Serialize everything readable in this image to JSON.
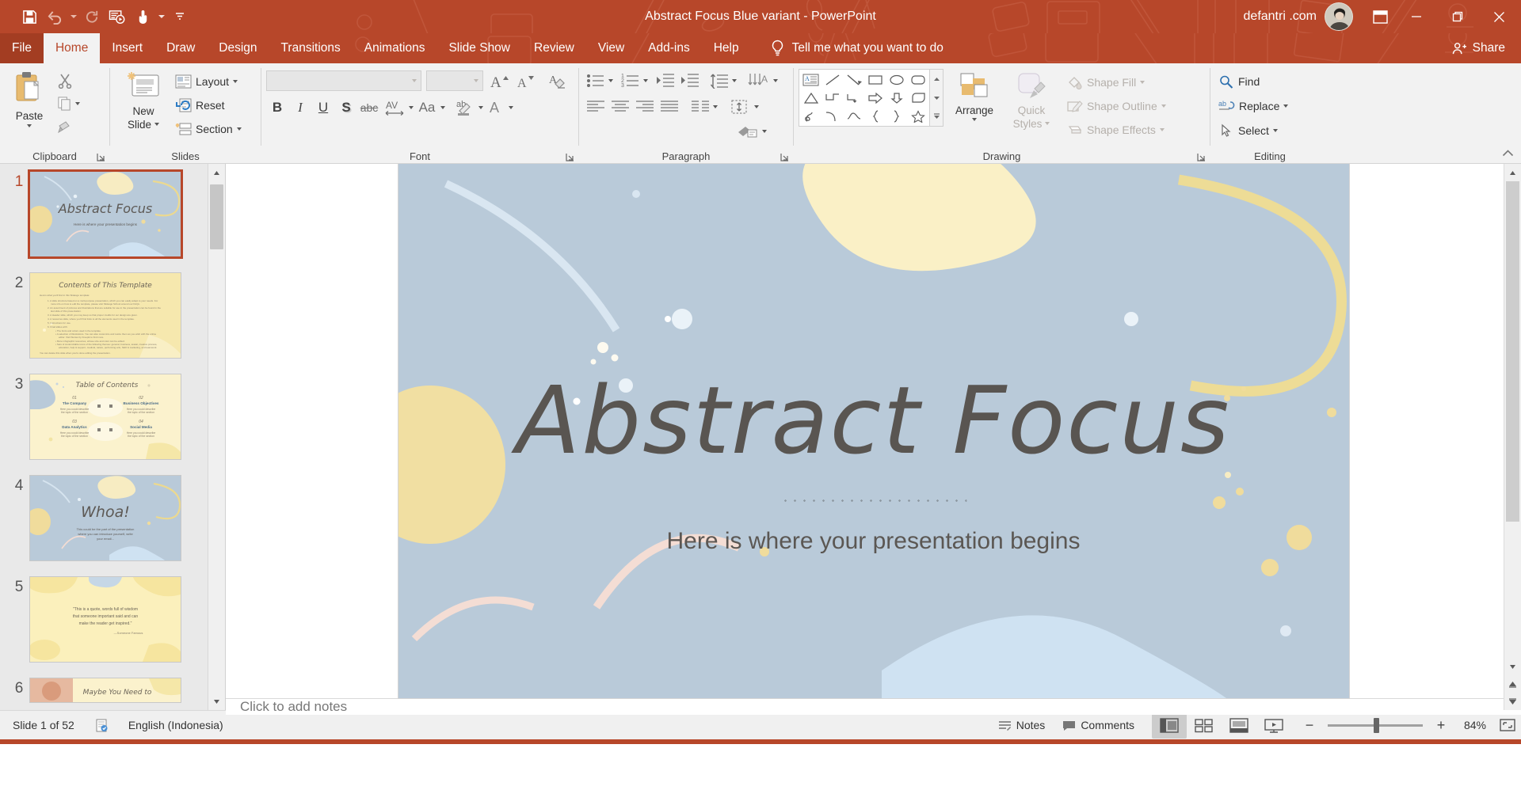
{
  "window": {
    "title": "Abstract Focus Blue variant  -  PowerPoint",
    "account_name": "defantri .com",
    "accent_color": "#b7472a",
    "quick_access": [
      {
        "name": "save",
        "icon": "save-icon"
      },
      {
        "name": "undo",
        "icon": "undo-icon"
      },
      {
        "name": "redo",
        "icon": "redo-icon"
      },
      {
        "name": "start-from-beginning",
        "icon": "slideshow-icon"
      },
      {
        "name": "touch-mouse-mode",
        "icon": "touch-icon"
      },
      {
        "name": "customize-quick-access-toolbar",
        "icon": "chevron-down-icon"
      }
    ],
    "controls": {
      "ribbon_display": "ribbon-display-options-icon",
      "minimize": "minimize-icon",
      "restore": "restore-icon",
      "close": "close-icon"
    }
  },
  "tabs": [
    {
      "label": "File",
      "active": false,
      "file": true
    },
    {
      "label": "Home",
      "active": true,
      "file": false
    },
    {
      "label": "Insert",
      "active": false,
      "file": false
    },
    {
      "label": "Draw",
      "active": false,
      "file": false
    },
    {
      "label": "Design",
      "active": false,
      "file": false
    },
    {
      "label": "Transitions",
      "active": false,
      "file": false
    },
    {
      "label": "Animations",
      "active": false,
      "file": false
    },
    {
      "label": "Slide Show",
      "active": false,
      "file": false
    },
    {
      "label": "Review",
      "active": false,
      "file": false
    },
    {
      "label": "View",
      "active": false,
      "file": false
    },
    {
      "label": "Add-ins",
      "active": false,
      "file": false
    },
    {
      "label": "Help",
      "active": false,
      "file": false
    }
  ],
  "tell_me": {
    "placeholder": "Tell me what you want to do"
  },
  "share": {
    "label": "Share"
  },
  "ribbon": {
    "groups": [
      {
        "name": "clipboard",
        "label": "Clipboard"
      },
      {
        "name": "slides",
        "label": "Slides"
      },
      {
        "name": "font",
        "label": "Font"
      },
      {
        "name": "paragraph",
        "label": "Paragraph"
      },
      {
        "name": "drawing",
        "label": "Drawing"
      },
      {
        "name": "editing",
        "label": "Editing"
      }
    ],
    "clipboard": {
      "paste": "Paste",
      "cut": "Cut",
      "copy": "Copy",
      "format_painter": "Format Painter"
    },
    "slides": {
      "new_slide": "New\nSlide",
      "new_slide_label": "New",
      "new_slide_label2": "Slide",
      "layout": "Layout",
      "reset": "Reset",
      "section": "Section"
    },
    "font": {
      "font_name": "",
      "font_size": "",
      "bold": "B",
      "italic": "I",
      "underline": "U",
      "shadow": "S",
      "strikethrough": "abc",
      "character_spacing": "AV",
      "change_case": "Aa",
      "increase_font_size": "A",
      "decrease_font_size": "A",
      "clear_formatting": "Clear All Formatting",
      "text_highlight": "ab",
      "font_color": "A"
    },
    "paragraph": {
      "bullets": "Bullets",
      "numbering": "Numbering",
      "decrease_indent": "Decrease List Level",
      "increase_indent": "Increase List Level",
      "line_spacing": "Line Spacing",
      "text_direction": "Text Direction",
      "align_text": "Align Text",
      "smartart": "Convert to SmartArt",
      "align_left": "Align Left",
      "center": "Center",
      "align_right": "Align Right",
      "justify": "Justify",
      "columns": "Columns"
    },
    "drawing": {
      "shapes": [
        "text-box-shape",
        "line-shape",
        "arrow-shape",
        "rectangle-shape",
        "oval-shape",
        "rounded-rectangle-shape",
        "triangle-shape",
        "elbow-connector-shape",
        "elbow-arrow-shape",
        "right-arrow-shape",
        "down-arrow-shape",
        "flowchart-shape",
        "scribble-shape",
        "curve-shape",
        "wave-shape",
        "left-brace-shape",
        "right-brace-shape",
        "star-shape"
      ],
      "arrange": "Arrange",
      "quick_styles_1": "Quick",
      "quick_styles_2": "Styles",
      "shape_fill": "Shape Fill",
      "shape_outline": "Shape Outline",
      "shape_effects": "Shape Effects"
    },
    "editing": {
      "find": "Find",
      "replace": "Replace",
      "select": "Select"
    }
  },
  "thumbnails": [
    {
      "number": "1",
      "selected": true,
      "variant": "title-blue",
      "title": "Abstract Focus",
      "subtitle": "Here is where your presentation begins"
    },
    {
      "number": "2",
      "selected": false,
      "variant": "contents",
      "title": "Contents of This Template",
      "subtitle": ""
    },
    {
      "number": "3",
      "selected": false,
      "variant": "toc",
      "title": "Table of Contents",
      "subtitle": ""
    },
    {
      "number": "4",
      "selected": false,
      "variant": "whoa",
      "title": "Whoa!",
      "subtitle": "This could be the part of the presentation where you can introduce yourself, write your email..."
    },
    {
      "number": "5",
      "selected": false,
      "variant": "quote",
      "title": "“This is a quote, words full of wisdom that someone important said and can make the reader get inspired.”",
      "subtitle": "—Someone Famous"
    },
    {
      "number": "6",
      "selected": false,
      "variant": "maybe",
      "title": "Maybe You Need to",
      "subtitle": ""
    }
  ],
  "toc_items": [
    {
      "num": "01",
      "label": "The Company",
      "desc": "Here you could describe the topic of the section"
    },
    {
      "num": "02",
      "label": "Business Objectives",
      "desc": "Here you could describe the topic of the section"
    },
    {
      "num": "03",
      "label": "Data Analytics",
      "desc": "Here you could describe the topic of the section"
    },
    {
      "num": "04",
      "label": "Social Media",
      "desc": "Here you could describe the topic of the section"
    }
  ],
  "slide": {
    "title": "Abstract Focus",
    "subtitle": "Here is where your presentation begins",
    "background_color": "#b9cad9",
    "title_color": "#595551"
  },
  "notes": {
    "placeholder": "Click to add notes"
  },
  "status": {
    "slide_indicator": "Slide 1 of 52",
    "accessibility": "accessibility-checker-icon",
    "language": "English (Indonesia)",
    "notes_label": "Notes",
    "comments_label": "Comments",
    "views": [
      {
        "name": "normal-view",
        "active": true
      },
      {
        "name": "slide-sorter-view",
        "active": false
      },
      {
        "name": "reading-view",
        "active": false
      },
      {
        "name": "slide-show-view",
        "active": false
      }
    ],
    "zoom_out": "−",
    "zoom_in": "+",
    "zoom_level": "84%",
    "fit_to_window": "fit-slide-to-window-icon"
  }
}
